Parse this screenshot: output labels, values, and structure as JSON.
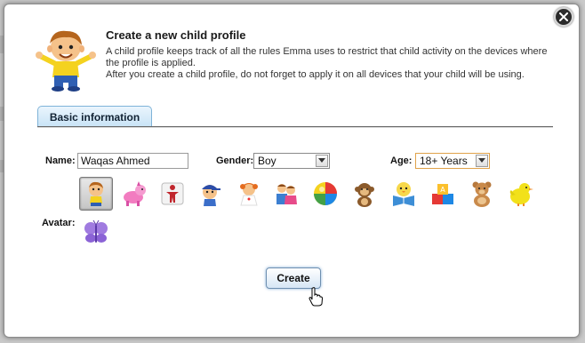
{
  "dialog": {
    "title": "Create a new child profile",
    "description_line1": "A child profile keeps track of all the rules Emma uses to restrict that child activity on the devices where the profile is applied.",
    "description_line2": "After you create a child profile, do not forget to apply it on all devices that your child will be using.",
    "close_icon": "close-icon"
  },
  "tabs": [
    {
      "label": "Basic information",
      "active": true
    }
  ],
  "form": {
    "name_label": "Name:",
    "name_value": "Waqas Ahmed",
    "gender_label": "Gender:",
    "gender_value": "Boy",
    "age_label": "Age:",
    "age_value": "18+ Years",
    "avatar_label": "Avatar:"
  },
  "avatars": [
    {
      "icon": "boy-avatar-icon",
      "selected": true
    },
    {
      "icon": "pink-horse-avatar-icon",
      "selected": false
    },
    {
      "icon": "figure-avatar-icon",
      "selected": false
    },
    {
      "icon": "boy-cap-avatar-icon",
      "selected": false
    },
    {
      "icon": "girl-avatar-icon",
      "selected": false
    },
    {
      "icon": "two-kids-avatar-icon",
      "selected": false
    },
    {
      "icon": "ball-avatar-icon",
      "selected": false
    },
    {
      "icon": "monkey-avatar-icon",
      "selected": false
    },
    {
      "icon": "reading-chick-avatar-icon",
      "selected": false
    },
    {
      "icon": "toy-blocks-avatar-icon",
      "selected": false
    },
    {
      "icon": "teddy-bear-avatar-icon",
      "selected": false
    },
    {
      "icon": "chick-avatar-icon",
      "selected": false
    },
    {
      "icon": "butterfly-avatar-icon",
      "selected": false
    }
  ],
  "actions": {
    "create_label": "Create"
  },
  "colors": {
    "tab_border": "#7fb3d8",
    "button_glow": "#508cc8",
    "age_select_border": "#e0a24a"
  }
}
